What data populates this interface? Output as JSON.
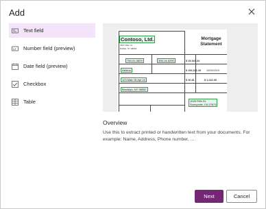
{
  "dialog": {
    "title": "Add",
    "close_icon": "close-icon"
  },
  "field_types": [
    {
      "label": "Text field",
      "icon": "text-field-icon",
      "selected": true
    },
    {
      "label": "Number field (preview)",
      "icon": "number-field-icon",
      "selected": false
    },
    {
      "label": "Date field (preview)",
      "icon": "calendar-icon",
      "selected": false
    },
    {
      "label": "Checkbox",
      "icon": "checkbox-icon",
      "selected": false
    },
    {
      "label": "Table",
      "icon": "table-icon",
      "selected": false
    }
  ],
  "preview": {
    "doc_title_line1": "Mortgage",
    "doc_title_line2": "Statement",
    "company": "Contoso, Ltd.",
    "company_addr1": "4567 Main St.",
    "company_addr2": "Buffalo, NY 98052",
    "phone1": "750-01-3829",
    "phone2": "306-14-5290",
    "borrower": "Helena",
    "address1": "123 Main St Apt 10",
    "address2": "Brooklyn, NY 98052",
    "mortgage_amount": "$ 15,343.34",
    "balance": "$ 154,321.33",
    "date": "10/09/2019",
    "escrow1": "$ 10.81",
    "escrow2": "$ 1,222.05",
    "property1": "1025 Fifth St.",
    "property2": "Sunnyvale, CA 27673",
    "count": "2"
  },
  "overview": {
    "heading": "Overview",
    "text": "Use this to extract printed or handwritten text from your documents. For example: Name, Address, Phone number, ..."
  },
  "buttons": {
    "next": "Next",
    "cancel": "Cancel"
  },
  "colors": {
    "accent": "#742774",
    "selected_bg": "#f4e4f9",
    "highlight_box": "#2e9c4a"
  }
}
